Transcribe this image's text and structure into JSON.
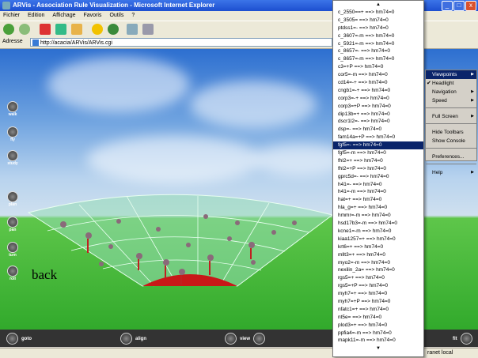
{
  "window": {
    "title": "ARVis - Association Rule Visualization - Microsoft Internet Explorer",
    "controls": [
      "_",
      "□",
      "x"
    ]
  },
  "menubar": [
    "Fichier",
    "Edition",
    "Affichage",
    "Favoris",
    "Outils",
    "?"
  ],
  "toolbar": {
    "icons": [
      "back-icon",
      "forward-icon",
      "stop-icon",
      "refresh-icon",
      "home-icon",
      "favorites-icon",
      "history-icon",
      "mail-icon",
      "print-icon"
    ]
  },
  "address": {
    "label": "Adresse",
    "url": "http://acacia/ARVis/ARVis.cgi"
  },
  "viewer": {
    "side_controls": [
      "walk",
      "fly",
      "study",
      "plan",
      "pan",
      "turn",
      "roll"
    ],
    "back_label": "back",
    "bottom_controls": [
      {
        "label": "goto"
      },
      {
        "label": "align"
      },
      {
        "label": "view"
      },
      {
        "label": "fit"
      }
    ],
    "rules": [
      "c_2550==+ ==> hm74=0",
      "c_3505= ==> hm74=0",
      "ptdss1=- ==> hm74=0",
      "c_3607=-m ==> hm74=0",
      "c_5921=-m ==> hm74=0",
      "c_8657=- ==> hm74=0",
      "c_8657=-m ==> hm74=0",
      "c3=+P ==> hm74=0",
      "cor5=-m ==> hm74=0",
      "cd14=-+ ==> hm74=0",
      "cngb1=-+ ==> hm74=0",
      "corp3=-+ ==> hm74=0",
      "corp3=+P ==> hm74=0",
      "dip13b=+ ==> hm74=0",
      "dscr1l2=- ==> hm74=0",
      "dsp=- ==> hm74=0",
      "fam14a=+P ==> hm74=0",
      "fgf5=- ==> hm74=0",
      "fgf5=-m ==> hm74=0",
      "fhl2=+ ==> hm74=0",
      "fhl2=+P ==> hm74=0",
      "gprc5d=- ==> hm74=0",
      "h41=- ==> hm74=0",
      "h41=-m ==> hm74=0",
      "hat=+ ==> hm74=0",
      "hla_g=+ ==> hm74=0",
      "hmmr=-m ==> hm74=0",
      "hsd17b3=-m ==> hm74=0",
      "kcne1=-m ==> hm74=0",
      "kiaa1257=+ ==> hm74=0",
      "krt6=+ ==> hm74=0",
      "mllt3=+ ==> hm74=0",
      "myo2=-m ==> hm74=0",
      "nexilin_2a= ==> hm74=0",
      "rgs5=+ ==> hm74=0",
      "rgs5=+P ==> hm74=0",
      "myh7=+ ==> hm74=0",
      "myh7=+P ==> hm74=0",
      "nfatc1=+ ==> hm74=0",
      "nt5e= ==> hm74=0",
      "plod3=+ ==> hm74=0",
      "ppfia4=-m ==> hm74=0",
      "mapk11=-m ==> hm74=0"
    ],
    "selected_rule_index": 17
  },
  "context_menu": {
    "items": [
      {
        "label": "Viewpoints",
        "submenu": true,
        "highlighted": true
      },
      {
        "label": "Headlight",
        "checked": true
      },
      {
        "label": "Navigation",
        "submenu": true
      },
      {
        "label": "Speed",
        "submenu": true
      },
      {
        "sep": true
      },
      {
        "label": "Full Screen",
        "submenu": true
      },
      {
        "sep": true
      },
      {
        "label": "Hide Toolbars"
      },
      {
        "label": "Show Console"
      },
      {
        "sep": true
      },
      {
        "label": "Preferences..."
      },
      {
        "sep": true
      },
      {
        "label": "Help",
        "submenu": true
      }
    ]
  },
  "status": {
    "zone": "ranet local"
  }
}
